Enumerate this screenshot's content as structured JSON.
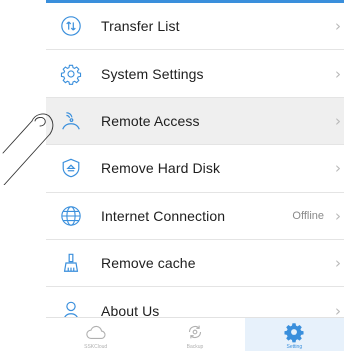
{
  "menu": {
    "items": [
      {
        "label": "Transfer List",
        "icon": "transfer-icon",
        "status": ""
      },
      {
        "label": "System Settings",
        "icon": "settings-gear-icon",
        "status": ""
      },
      {
        "label": "Remote Access",
        "icon": "remote-access-icon",
        "status": ""
      },
      {
        "label": "Remove Hard Disk",
        "icon": "eject-shield-icon",
        "status": ""
      },
      {
        "label": "Internet Connection",
        "icon": "globe-icon",
        "status": "Offline"
      },
      {
        "label": "Remove cache",
        "icon": "broom-icon",
        "status": ""
      },
      {
        "label": "About Us",
        "icon": "info-person-icon",
        "status": ""
      }
    ],
    "chevron": "›"
  },
  "tabbar": {
    "tabs": [
      {
        "label": "SSKCloud",
        "icon": "cloud-icon"
      },
      {
        "label": "Backup",
        "icon": "backup-icon"
      },
      {
        "label": "Setting",
        "icon": "gear-icon"
      }
    ]
  },
  "colors": {
    "accent": "#3a8fdc",
    "icon": "#3a8fdc",
    "row_active": "#efefef",
    "text": "#1e1e1e",
    "muted": "#8a8a8a"
  }
}
